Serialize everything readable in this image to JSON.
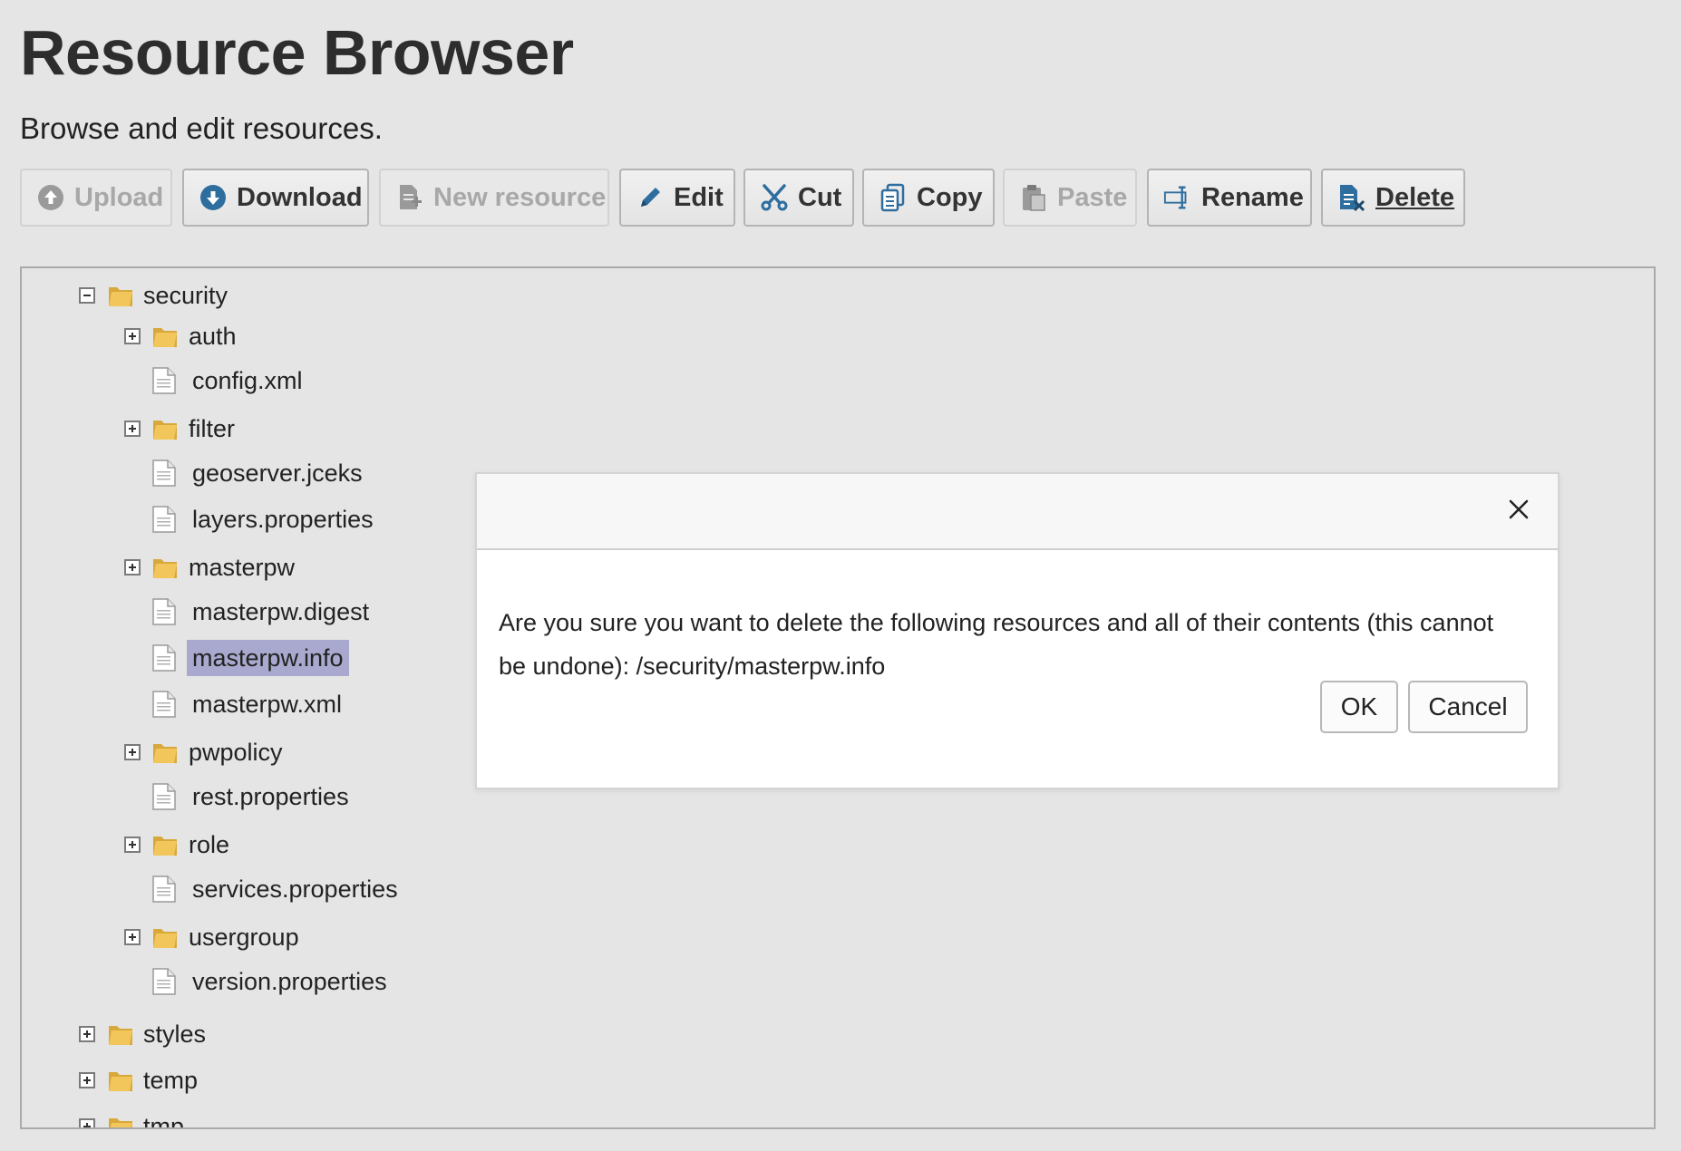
{
  "header": {
    "title": "Resource Browser",
    "subtitle": "Browse and edit resources."
  },
  "toolbar": {
    "buttons": [
      {
        "label": "Upload",
        "icon": "upload-circle-icon",
        "enabled": false
      },
      {
        "label": "Download",
        "icon": "download-circle-icon",
        "enabled": true
      },
      {
        "label": "New resource",
        "icon": "new-document-icon",
        "enabled": false
      },
      {
        "label": "Edit",
        "icon": "pencil-icon",
        "enabled": true
      },
      {
        "label": "Cut",
        "icon": "scissors-icon",
        "enabled": true
      },
      {
        "label": "Copy",
        "icon": "copy-icon",
        "enabled": true
      },
      {
        "label": "Paste",
        "icon": "clipboard-icon",
        "enabled": false
      },
      {
        "label": "Rename",
        "icon": "rename-icon",
        "enabled": true
      },
      {
        "label": "Delete",
        "icon": "delete-document-icon",
        "enabled": true
      }
    ]
  },
  "tree": {
    "root": {
      "label": "security",
      "expanded": true
    },
    "children": [
      {
        "label": "auth",
        "type": "folder",
        "expanded": false
      },
      {
        "label": "config.xml",
        "type": "file"
      },
      {
        "label": "filter",
        "type": "folder",
        "expanded": false
      },
      {
        "label": "geoserver.jceks",
        "type": "file"
      },
      {
        "label": "layers.properties",
        "type": "file"
      },
      {
        "label": "masterpw",
        "type": "folder",
        "expanded": false
      },
      {
        "label": "masterpw.digest",
        "type": "file"
      },
      {
        "label": "masterpw.info",
        "type": "file",
        "selected": true
      },
      {
        "label": "masterpw.xml",
        "type": "file"
      },
      {
        "label": "pwpolicy",
        "type": "folder",
        "expanded": false
      },
      {
        "label": "rest.properties",
        "type": "file"
      },
      {
        "label": "role",
        "type": "folder",
        "expanded": false
      },
      {
        "label": "services.properties",
        "type": "file"
      },
      {
        "label": "usergroup",
        "type": "folder",
        "expanded": false
      },
      {
        "label": "version.properties",
        "type": "file"
      }
    ],
    "siblings": [
      {
        "label": "styles",
        "type": "folder",
        "expanded": false
      },
      {
        "label": "temp",
        "type": "folder",
        "expanded": false
      },
      {
        "label": "tmp",
        "type": "folder",
        "expanded": false
      }
    ]
  },
  "dialog": {
    "message": "Are you sure you want to delete the following resources and all of their contents (this cannot be undone): /security/masterpw.info",
    "ok_label": "OK",
    "cancel_label": "Cancel"
  },
  "colors": {
    "background": "#e5e5e5",
    "selection": "#a9a9cf",
    "folder": "#e6b84a",
    "icon_blue": "#2e6e9e"
  }
}
